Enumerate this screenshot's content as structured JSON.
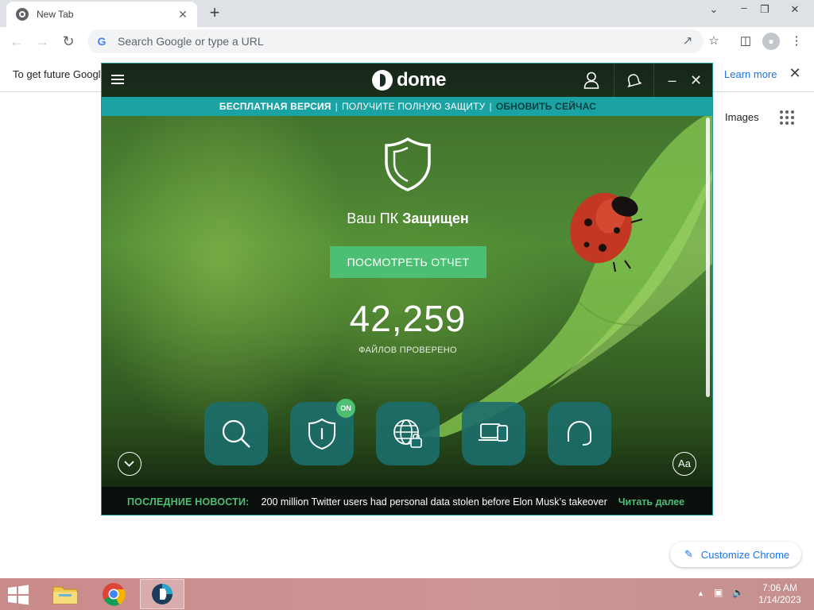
{
  "browser": {
    "tab_title": "New Tab",
    "tab_close": "✕",
    "new_tab": "+",
    "omnibox_placeholder": "Search Google or type a URL",
    "omnibox_g": "G",
    "infobar_message": "To get future Googl",
    "infobar_link": "Learn more",
    "infobar_close": "✕",
    "page_images_link": "Images",
    "customize_label": "Customize Chrome"
  },
  "dome": {
    "logo_text": "dome",
    "promo": {
      "free": "БЕСПЛАТНАЯ ВЕРСИЯ",
      "sep": "|",
      "get_full": "ПОЛУЧИТЕ ПОЛНУЮ ЗАЩИТУ",
      "update": "ОБНОВИТЬ СЕЙЧАС"
    },
    "status_prefix": "Ваш ПК",
    "status_value": "Защищен",
    "report_button": "ПОСМОТРЕТЬ ОТЧЕТ",
    "files_count": "42,259",
    "files_label": "ФАЙЛОВ ПРОВЕРЕНО",
    "on_badge": "ON",
    "font_button": "Aa",
    "news_label": "ПОСЛЕДНИЕ НОВОСТИ:",
    "news_headline": "200 million Twitter users had personal data stolen before Elon Musk’s takeover",
    "news_more": "Читать далее",
    "features": [
      {
        "icon": "search-icon"
      },
      {
        "icon": "shield-icon"
      },
      {
        "icon": "globe-lock-icon"
      },
      {
        "icon": "devices-icon"
      },
      {
        "icon": "headset-icon"
      }
    ],
    "colors": {
      "accent_teal": "#1ba3a3",
      "accent_green": "#4cbf75"
    }
  },
  "taskbar": {
    "time": "7:06 AM",
    "date": "1/14/2023"
  }
}
